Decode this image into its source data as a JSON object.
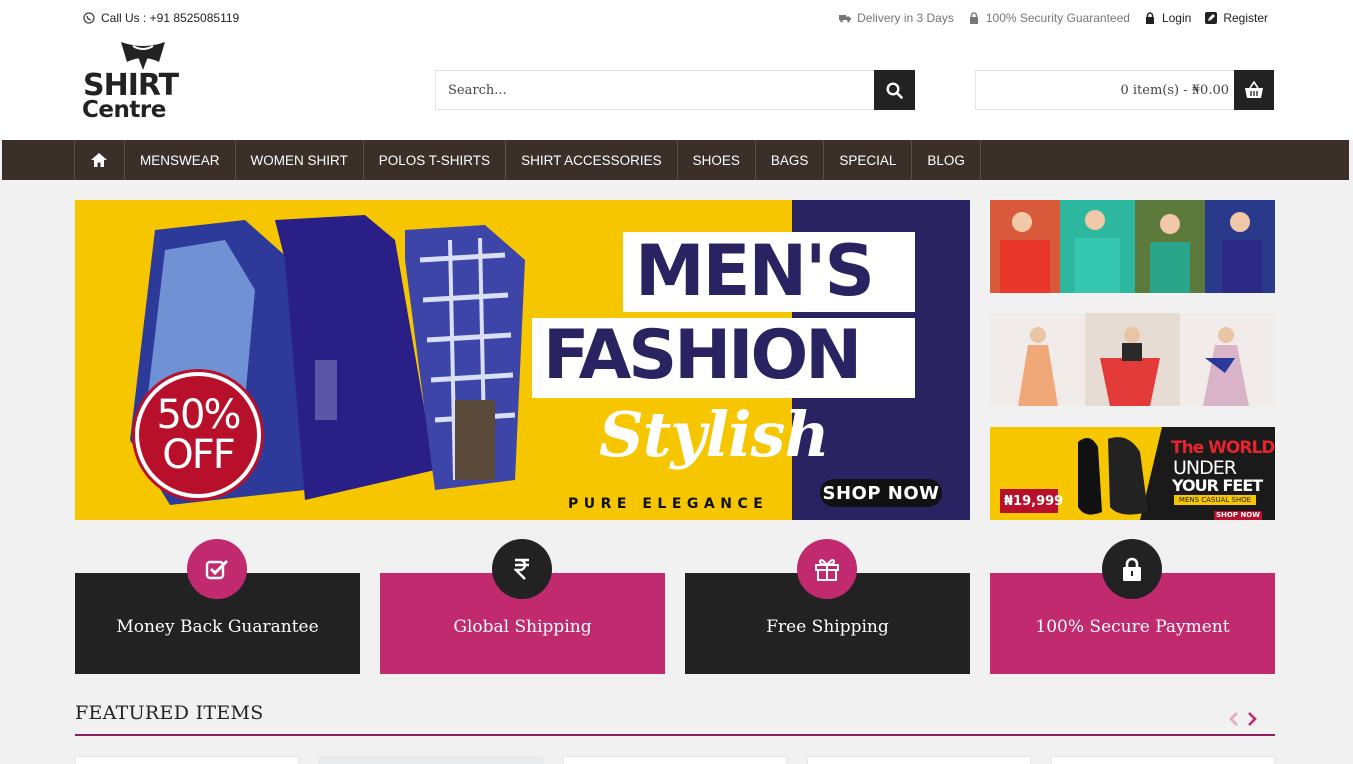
{
  "topbar": {
    "call_us": "Call Us : +91 8525085119",
    "delivery": "Delivery in 3 Days",
    "security": "100% Security Guaranteed",
    "login": "Login",
    "register": "Register"
  },
  "logo": {
    "line1": "SHIRT",
    "line2": "Centre"
  },
  "search": {
    "placeholder": "Search..."
  },
  "cart": {
    "summary": "0 item(s) - ₦0.00"
  },
  "nav": {
    "items": [
      "MENSWEAR",
      "WOMEN SHIRT",
      "POLOS T-SHIRTS",
      "SHIRT ACCESSORIES",
      "SHOES",
      "BAGS",
      "SPECIAL",
      "BLOG"
    ]
  },
  "banner": {
    "line1": "MEN'S",
    "line2": "FASHION",
    "line3": "Stylish",
    "tagline": "PURE ELEGANCE",
    "cta": "SHOP NOW",
    "discount": "50% OFF",
    "colors": {
      "yellow": "#f6c600",
      "navy": "#2a2361",
      "red": "#b8102a"
    }
  },
  "side_banners": {
    "shoes": {
      "price": "₦19,999",
      "headline1": "The WORLD",
      "headline2": "UNDER",
      "headline3": "YOUR FEET",
      "sub": "MENS CASUAL SHOE",
      "cta": "SHOP NOW"
    }
  },
  "features": [
    {
      "label": "Money Back Guarantee",
      "icon": "check-square-icon"
    },
    {
      "label": "Global Shipping",
      "icon": "rupee-icon"
    },
    {
      "label": "Free Shipping",
      "icon": "gift-icon"
    },
    {
      "label": "100% Secure Payment",
      "icon": "lock-icon"
    }
  ],
  "featured": {
    "title": "FEATURED ITEMS"
  },
  "colors": {
    "accent": "#c12a6f",
    "nav_bg": "#3b2f2a",
    "dark": "#222222"
  }
}
